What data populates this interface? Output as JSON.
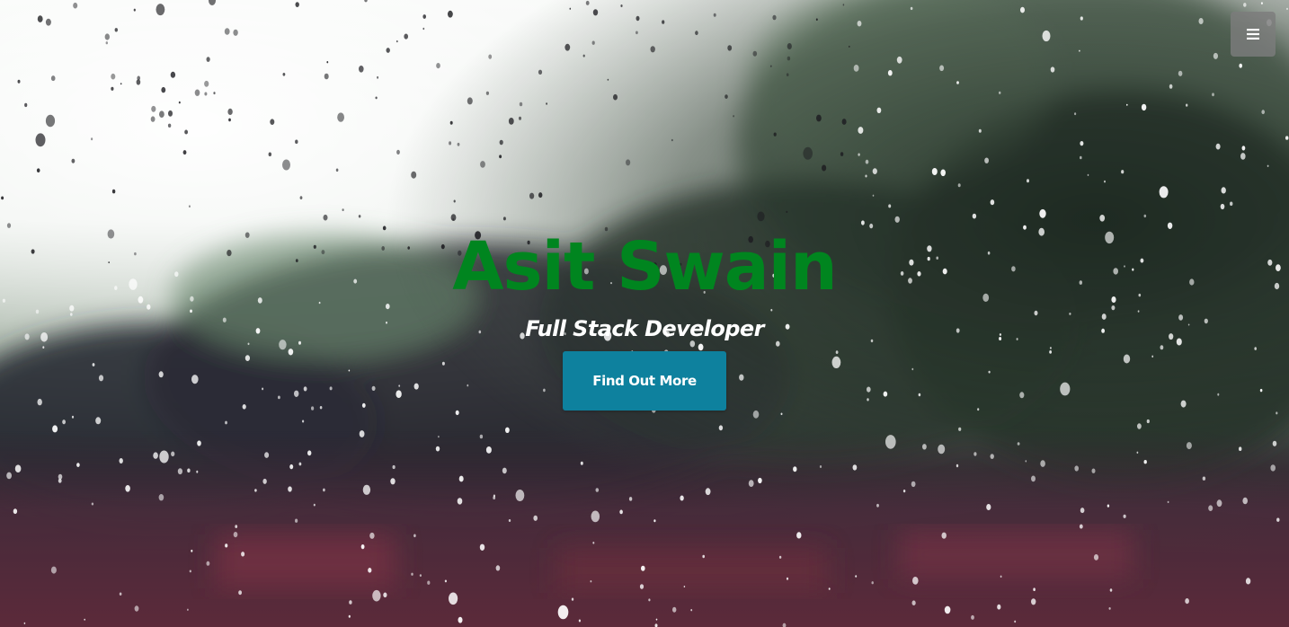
{
  "hero": {
    "title": "Asit Swain",
    "subtitle": "Full Stack Developer",
    "cta_label": "Find Out More",
    "background_image": "rain-drops-on-window-photo"
  },
  "nav": {
    "menu_icon": "hamburger-menu-icon"
  },
  "colors": {
    "title": "#00851f",
    "subtitle": "#ffffff",
    "cta_background": "#0e819e",
    "cta_text": "#ffffff",
    "menu_button": "#7d7d7d"
  }
}
